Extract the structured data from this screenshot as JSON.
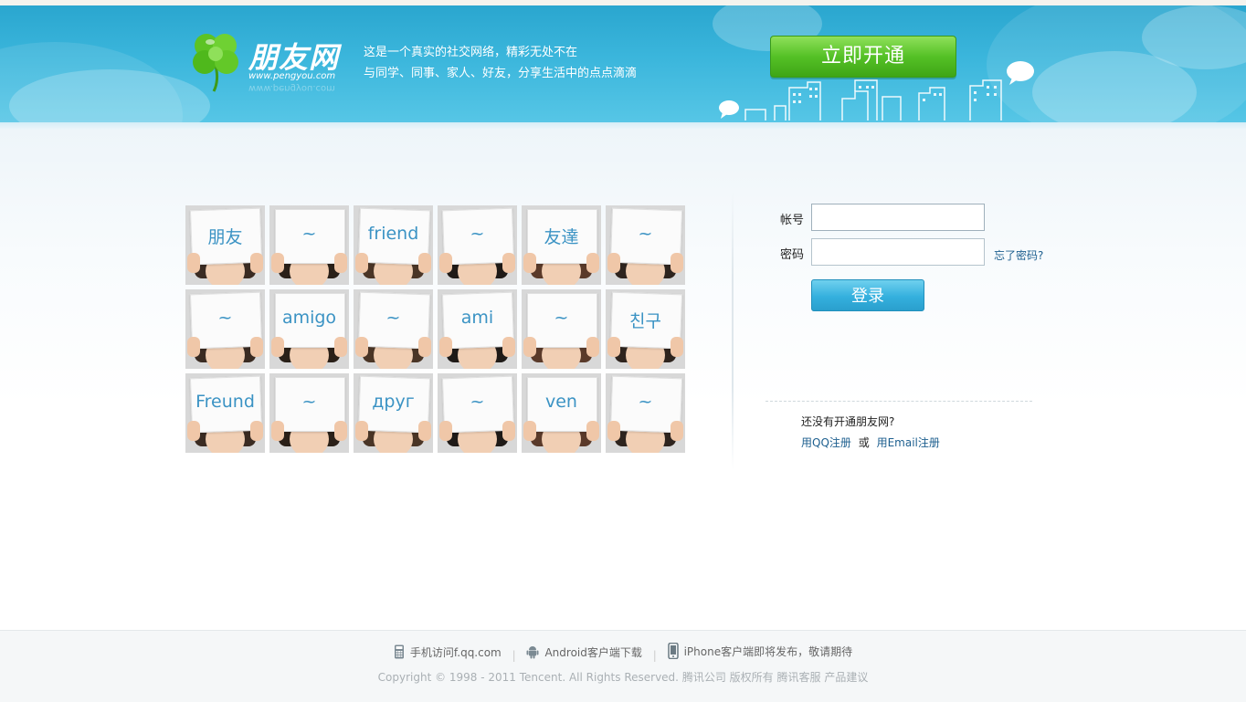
{
  "header": {
    "logo_title": "朋友网",
    "logo_url": "www.pengyou.com",
    "tagline_line1": "这是一个真实的社交网络，精彩无处不在",
    "tagline_line2": "与同学、同事、家人、好友，分享生活中的点点滴滴",
    "open_button_label": "立即开通"
  },
  "photo_grid": {
    "words": [
      "朋友",
      "~",
      "friend",
      "~",
      "友達",
      "~",
      "~",
      "amigo",
      "~",
      "ami",
      "~",
      "친구",
      "Freund",
      "~",
      "друг",
      "~",
      "ven",
      "~"
    ]
  },
  "login": {
    "account_label": "帐号",
    "account_value": "",
    "password_label": "密码",
    "password_value": "",
    "forgot_label": "忘了密码?",
    "login_button_label": "登录",
    "no_account_text": "还没有开通朋友网?",
    "qq_register_label": "用QQ注册",
    "or_text": "或",
    "email_register_label": "用Email注册"
  },
  "footer": {
    "mobile_label": "手机访问f.qq.com",
    "android_label": "Android客户端下载",
    "iphone_label": "iPhone客户端即将发布，敬请期待",
    "copyright_text": "Copyright © 1998 - 2011 Tencent. All Rights Reserved.",
    "company_link": "腾讯公司",
    "rights_text": "版权所有",
    "service_link": "腾讯客服",
    "suggest_link": "产品建议"
  },
  "colors": {
    "header_blue": "#3bb6dc",
    "open_button_green": "#55c126",
    "login_button_blue": "#34b0de",
    "link_blue": "#1d5f8f",
    "word_blue": "#3b93c4"
  },
  "icons": [
    "clover-logo-icon",
    "speech-bubble-icon",
    "phone-icon",
    "android-icon",
    "iphone-icon"
  ]
}
